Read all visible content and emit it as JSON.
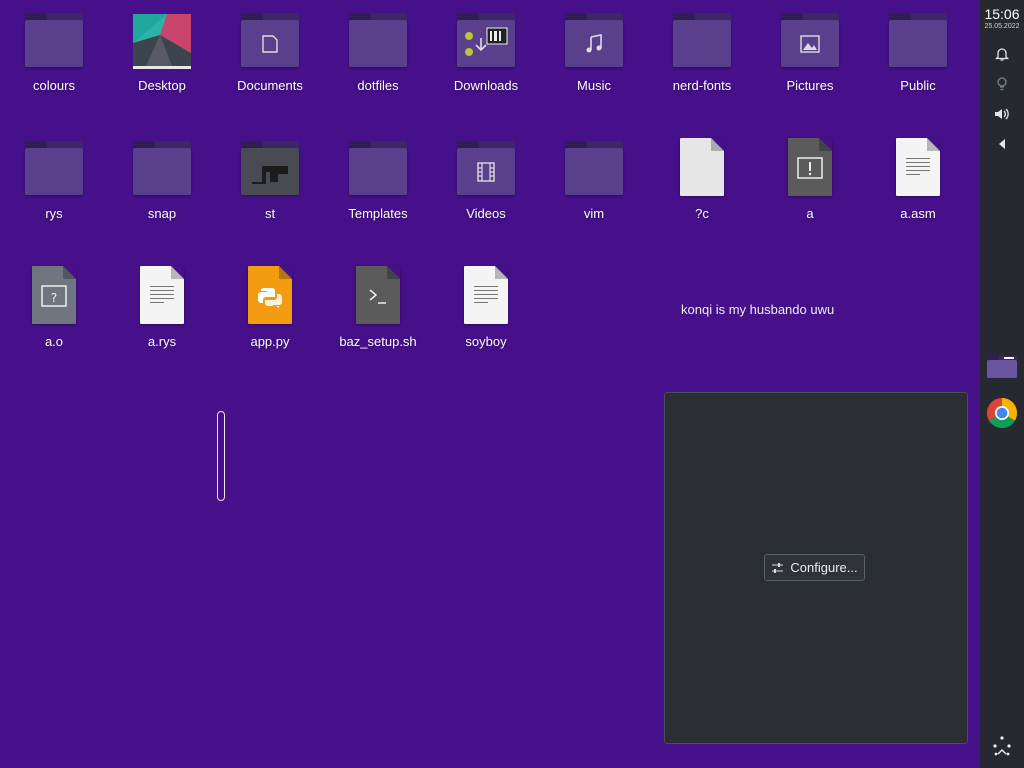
{
  "desktop": {
    "icons": [
      {
        "label": "colours",
        "type": "folder"
      },
      {
        "label": "Desktop",
        "type": "desktop-folder"
      },
      {
        "label": "Documents",
        "type": "folder-documents"
      },
      {
        "label": "dotfiles",
        "type": "folder"
      },
      {
        "label": "Downloads",
        "type": "folder-downloads"
      },
      {
        "label": "Music",
        "type": "folder-music"
      },
      {
        "label": "nerd-fonts",
        "type": "folder"
      },
      {
        "label": "Pictures",
        "type": "folder-pictures"
      },
      {
        "label": "Public",
        "type": "folder"
      },
      {
        "label": "rys",
        "type": "folder"
      },
      {
        "label": "snap",
        "type": "folder"
      },
      {
        "label": "st",
        "type": "folder-st"
      },
      {
        "label": "Templates",
        "type": "folder"
      },
      {
        "label": "Videos",
        "type": "folder-videos"
      },
      {
        "label": "vim",
        "type": "folder"
      },
      {
        "label": "?c",
        "type": "file-blank"
      },
      {
        "label": "a",
        "type": "file-executable"
      },
      {
        "label": "a.asm",
        "type": "file-text"
      },
      {
        "label": "a.o",
        "type": "file-unknown"
      },
      {
        "label": "a.rys",
        "type": "file-text"
      },
      {
        "label": "app.py",
        "type": "file-python"
      },
      {
        "label": "baz_setup.sh",
        "type": "file-shell"
      },
      {
        "label": "soyboy",
        "type": "file-text"
      }
    ],
    "note_text": "konqi is my husbando uwu"
  },
  "widget": {
    "configure_label": "Configure..."
  },
  "panel": {
    "time": "15:06",
    "date": "25.05.2022",
    "tray": [
      "bell-icon",
      "lightbulb-icon",
      "volume-icon",
      "expand-arrow-icon"
    ],
    "apps": [
      "file-manager-icon",
      "chrome-icon"
    ]
  },
  "colors": {
    "wallpaper": "#45108a",
    "panel": "#262a30",
    "widget": "#2a2d32",
    "folder": "#5a3f8c"
  }
}
